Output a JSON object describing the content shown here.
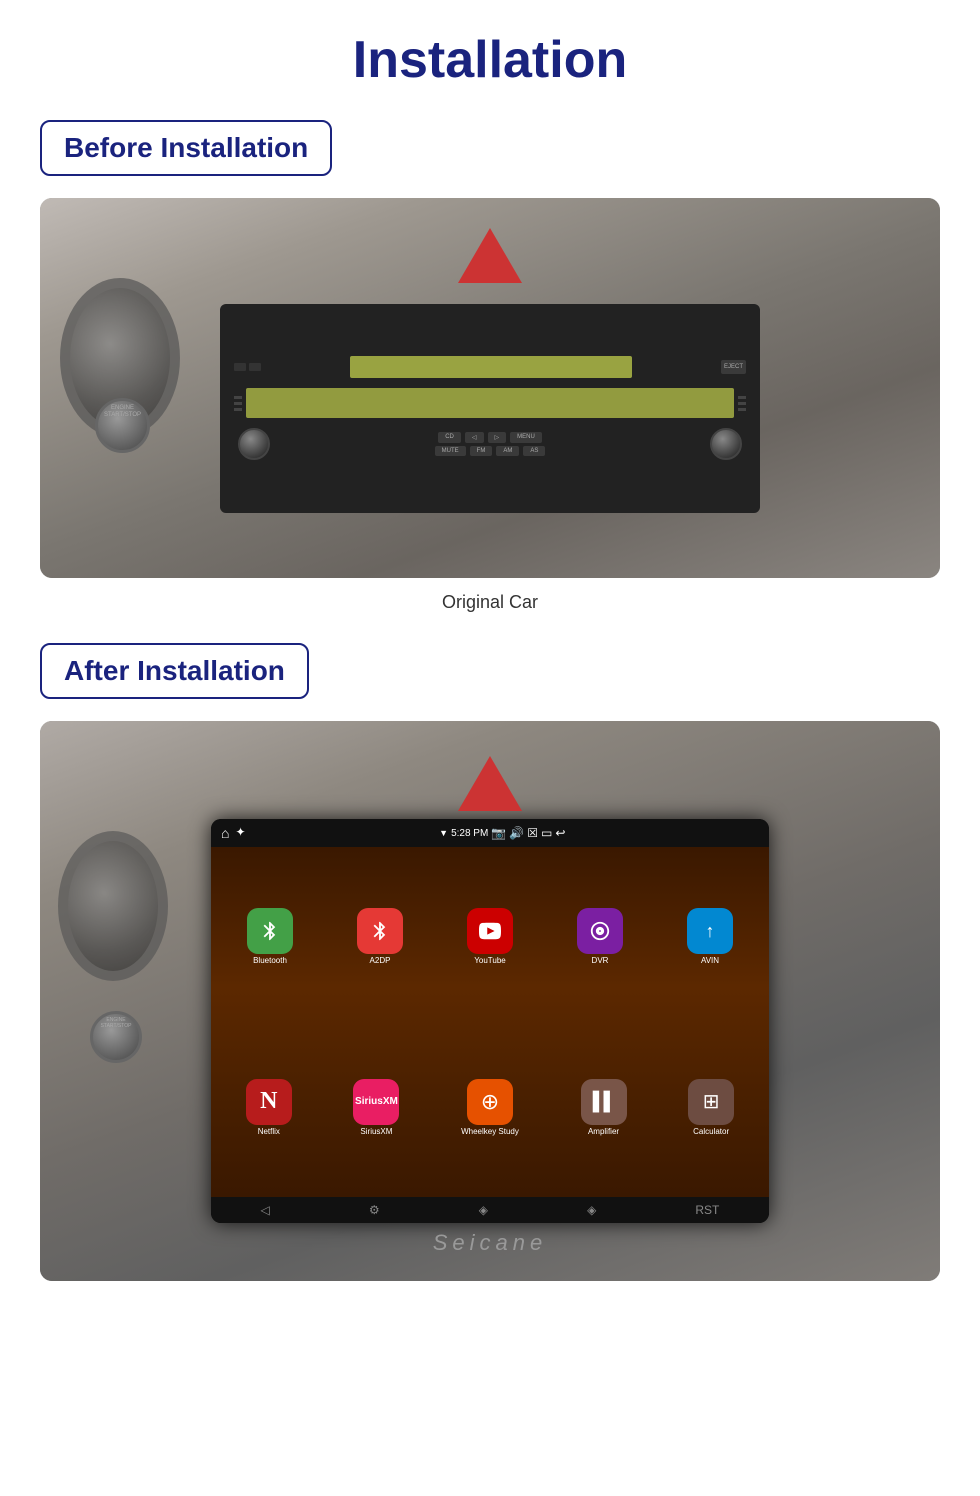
{
  "page": {
    "title": "Installation",
    "before_label": "Before Installation",
    "after_label": "After Installation",
    "caption": "Original Car",
    "seicane_brand": "Seicane"
  },
  "before_image": {
    "alt": "Car dashboard before installation showing original radio unit"
  },
  "after_image": {
    "alt": "Car dashboard after installation showing new Android head unit"
  },
  "apps_row1": [
    {
      "name": "Bluetooth",
      "icon": "bluetooth",
      "bg": "bg-green"
    },
    {
      "name": "A2DP",
      "icon": "A2",
      "bg": "bg-red-bt"
    },
    {
      "name": "YouTube",
      "icon": "▶",
      "bg": "bg-red-yt"
    },
    {
      "name": "DVR",
      "icon": "⊙",
      "bg": "bg-purple"
    },
    {
      "name": "AVIN",
      "icon": "↑",
      "bg": "bg-blue"
    }
  ],
  "apps_row2": [
    {
      "name": "Netflix",
      "icon": "N",
      "bg": "bg-dark-red"
    },
    {
      "name": "SiriusXM",
      "icon": "S",
      "bg": "bg-pink"
    },
    {
      "name": "Wheelkey Study",
      "icon": "⊕",
      "bg": "bg-orange"
    },
    {
      "name": "Amplifier",
      "icon": "▌▌",
      "bg": "bg-brown"
    },
    {
      "name": "Calculator",
      "icon": "⊞",
      "bg": "bg-brown2"
    }
  ],
  "status_bar": {
    "time": "5:28 PM",
    "home_icon": "⌂",
    "nav_icon": "✦"
  }
}
